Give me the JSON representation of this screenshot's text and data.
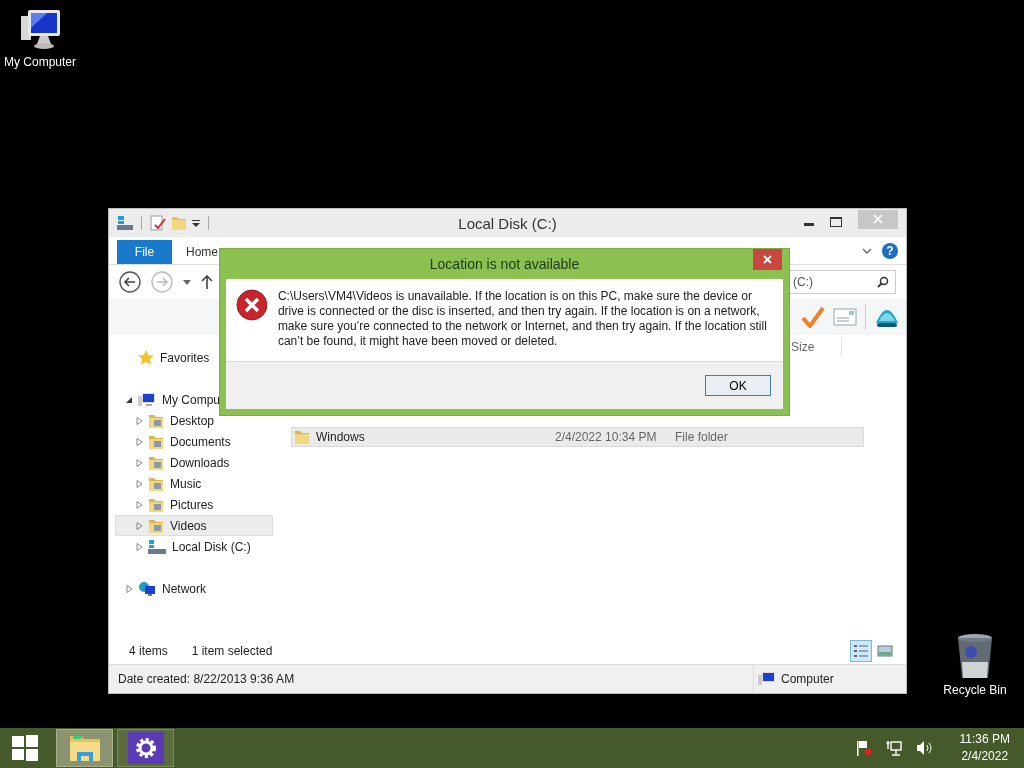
{
  "desktop_icons": [
    {
      "kind": "computer",
      "label": "My Computer"
    },
    {
      "kind": "recycle",
      "label": "Recycle Bin"
    }
  ],
  "explorer": {
    "title": "Local Disk (C:)",
    "file_tab": "File",
    "tabs": [
      {
        "label": "Home",
        "selected": false
      }
    ],
    "help_button": "?",
    "address": "(C:)",
    "column_header": "Size",
    "nav": [
      {
        "label": "Favorites",
        "kind": "favorites",
        "selected": false
      },
      {
        "label": "My Compu",
        "kind": "computer",
        "expanded": true,
        "selected": false,
        "children": [
          {
            "label": "Desktop",
            "kind": "folder",
            "expanded": false,
            "selected": false
          },
          {
            "label": "Documents",
            "kind": "folder",
            "expanded": false,
            "selected": false
          },
          {
            "label": "Downloads",
            "kind": "folder",
            "expanded": false,
            "selected": false
          },
          {
            "label": "Music",
            "kind": "folder",
            "expanded": false,
            "selected": false
          },
          {
            "label": "Pictures",
            "kind": "folder",
            "expanded": false,
            "selected": false
          },
          {
            "label": "Videos",
            "kind": "folder",
            "expanded": false,
            "selected": true
          },
          {
            "label": "Local Disk (C:)",
            "kind": "drive",
            "expanded": false,
            "selected": false
          }
        ]
      },
      {
        "label": "Network",
        "kind": "network",
        "expanded": false,
        "selected": false
      }
    ],
    "files": [
      {
        "name": "Windows",
        "date": "2/4/2022 10:34 PM",
        "type": "File folder",
        "selected": true
      }
    ],
    "status": {
      "items": "4 items",
      "selection": "1 item selected"
    },
    "views": [
      {
        "kind": "details",
        "selected": true
      },
      {
        "kind": "preview",
        "selected": false
      }
    ],
    "details_bar": {
      "info": "Date created: 8/22/2013 9:36 AM",
      "location": "Computer"
    }
  },
  "dialog": {
    "title": "Location is not available",
    "message": "C:\\Users\\VM4\\Videos is unavailable. If the location is on this PC, make sure the device or drive is connected or the disc is inserted, and then try again. If the location is on a network, make sure you’re connected to the network or Internet, and then try again. If the location still can’t be found, it might have been moved or deleted.",
    "button": "OK"
  },
  "taskbar": {
    "apps": [
      {
        "kind": "explorer",
        "selected": true
      },
      {
        "kind": "settings",
        "selected": false
      }
    ],
    "clock": {
      "time": "11:36 PM",
      "date": "2/4/2022"
    }
  }
}
